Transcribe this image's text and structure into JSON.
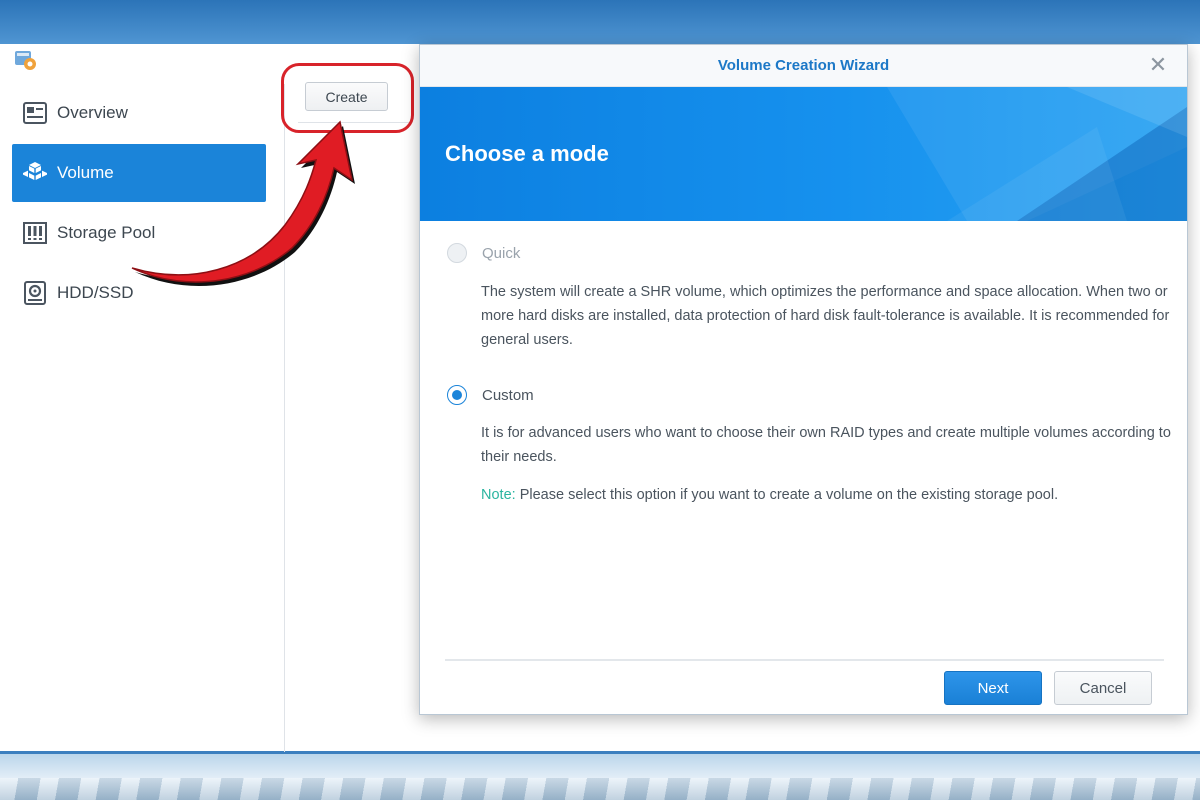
{
  "app": {
    "sidebar": {
      "items": [
        {
          "label": "Overview",
          "icon": "overview-icon",
          "active": false
        },
        {
          "label": "Volume",
          "icon": "volume-icon",
          "active": true
        },
        {
          "label": "Storage Pool",
          "icon": "storage-pool-icon",
          "active": false
        },
        {
          "label": "HDD/SSD",
          "icon": "hdd-icon",
          "active": false
        }
      ]
    },
    "toolbar": {
      "create_label": "Create"
    }
  },
  "wizard": {
    "title": "Volume Creation Wizard",
    "heading": "Choose a mode",
    "options": [
      {
        "label": "Quick",
        "selected": false,
        "enabled": false,
        "description": "The system will create a SHR volume, which optimizes the performance and space allocation. When two or more hard disks are installed, data protection of hard disk fault-tolerance is available. It is recommended for general users."
      },
      {
        "label": "Custom",
        "selected": true,
        "enabled": true,
        "description": "It is for advanced users who want to choose their own RAID types and create multiple volumes according to their needs.",
        "note_label": "Note:",
        "note_text": " Please select this option if you want to create a volume on the existing storage pool."
      }
    ],
    "buttons": {
      "next": "Next",
      "cancel": "Cancel"
    }
  },
  "colors": {
    "accent": "#1b84d9",
    "title_blue": "#1c78c7",
    "banner_blue": "#0c7fe0",
    "note_green": "#2bb5a0",
    "highlight_red": "#d8232a"
  }
}
